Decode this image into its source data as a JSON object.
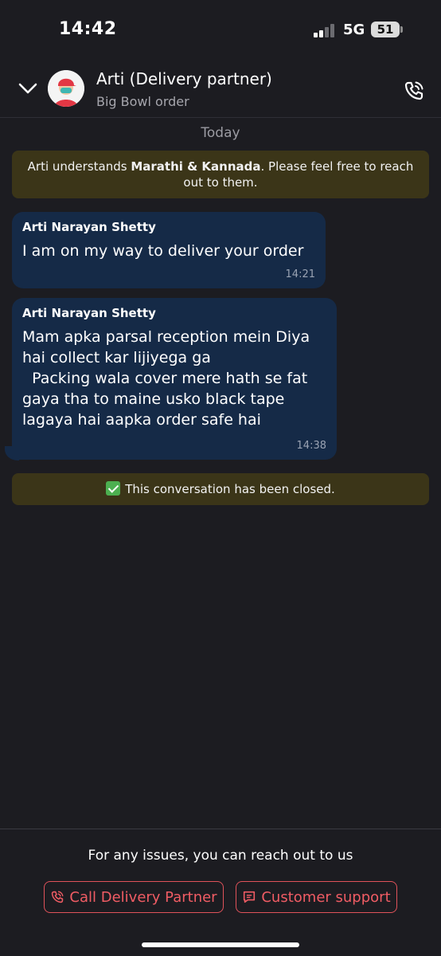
{
  "status_bar": {
    "time": "14:42",
    "network": "5G",
    "battery": "51"
  },
  "header": {
    "title": "Arti (Delivery partner)",
    "subtitle": "Big Bowl order"
  },
  "date_separator": "Today",
  "language_notice": {
    "prefix": "Arti understands ",
    "languages": "Marathi & Kannada",
    "suffix": ". Please feel free to reach out to them."
  },
  "messages": [
    {
      "sender": "Arti Narayan Shetty",
      "text": "I am on my way to deliver your order",
      "time": "14:21"
    },
    {
      "sender": "Arti Narayan Shetty",
      "text": "Mam apka parsal reception mein Diya hai collect kar lijiyega ga\n  Packing wala cover mere hath se fat gaya tha to maine usko black tape lagaya hai aapka order safe hai",
      "time": "14:38"
    }
  ],
  "closed_notice": "This conversation has been closed.",
  "footer": {
    "text": "For any issues, you can reach out to us",
    "call_button": "Call Delivery Partner",
    "support_button": "Customer support"
  },
  "colors": {
    "background": "#1c1c21",
    "bubble": "#152a47",
    "notice": "#3b3518",
    "accent": "#f05c64"
  },
  "icons": {
    "back": "chevron-down-icon",
    "call": "phone-call-icon",
    "support": "chat-icon",
    "check": "check-icon"
  }
}
